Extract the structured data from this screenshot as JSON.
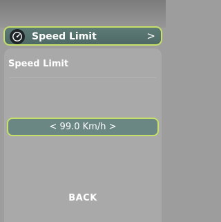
{
  "header": {
    "icon": "speedometer-icon",
    "label": "Speed Limit",
    "chevron": ">"
  },
  "panel": {
    "title": "Speed Limit",
    "value_display": "< 99.0 Km/h >",
    "back_label": "BACK"
  },
  "colors": {
    "accent_border": "#c6e06a",
    "header_fill": "#5d7a76",
    "selector_fill": "#6b8784",
    "panel_fill": "#a9a9a9"
  }
}
